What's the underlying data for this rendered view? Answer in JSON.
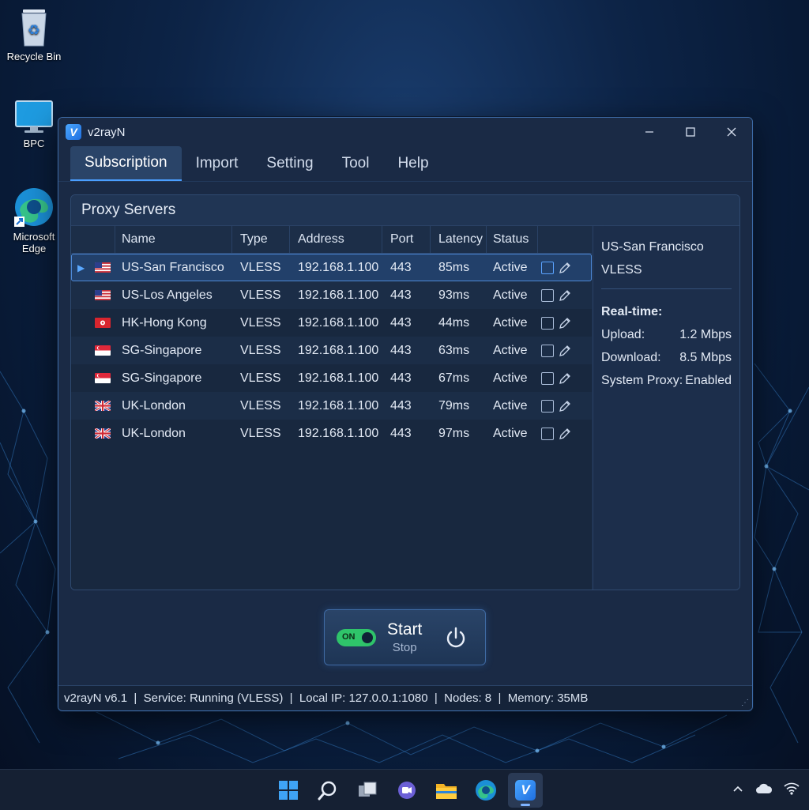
{
  "desktop": {
    "icons": [
      {
        "label": "Recycle Bin",
        "icon": "recycle-bin-icon"
      },
      {
        "label": "BPC",
        "icon": "monitor-icon"
      },
      {
        "label": "Microsoft Edge",
        "icon": "edge-icon"
      }
    ]
  },
  "window": {
    "title": "v2rayN",
    "controls": [
      "minimize-icon",
      "maximize-icon",
      "close-icon"
    ]
  },
  "menu": {
    "items": [
      {
        "label": "Subscription",
        "active": true
      },
      {
        "label": "Import"
      },
      {
        "label": "Setting"
      },
      {
        "label": "Tool"
      },
      {
        "label": "Help"
      }
    ]
  },
  "panel": {
    "title": "Proxy Servers",
    "columns": {
      "name": "Name",
      "type": "Type",
      "address": "Address",
      "port": "Port",
      "latency": "Latency",
      "status": "Status"
    },
    "rows": [
      {
        "flag": "us",
        "name": "US-San Francisco",
        "type": "VLESS",
        "address": "192.168.1.100",
        "port": "443",
        "latency": "85ms",
        "status": "Active",
        "selected": true
      },
      {
        "flag": "us",
        "name": "US-Los Angeles",
        "type": "VLESS",
        "address": "192.168.1.100",
        "port": "443",
        "latency": "93ms",
        "status": "Active"
      },
      {
        "flag": "hk",
        "name": "HK-Hong Kong",
        "type": "VLESS",
        "address": "192.168.1.100",
        "port": "443",
        "latency": "44ms",
        "status": "Active"
      },
      {
        "flag": "sg",
        "name": "SG-Singapore",
        "type": "VLESS",
        "address": "192.168.1.100",
        "port": "443",
        "latency": "63ms",
        "status": "Active"
      },
      {
        "flag": "sg",
        "name": "SG-Singapore",
        "type": "VLESS",
        "address": "192.168.1.100",
        "port": "443",
        "latency": "67ms",
        "status": "Active"
      },
      {
        "flag": "uk",
        "name": "UK-London",
        "type": "VLESS",
        "address": "192.168.1.100",
        "port": "443",
        "latency": "79ms",
        "status": "Active"
      },
      {
        "flag": "uk",
        "name": "UK-London",
        "type": "VLESS",
        "address": "192.168.1.100",
        "port": "443",
        "latency": "97ms",
        "status": "Active"
      }
    ]
  },
  "details": {
    "server_name": "US-San Francisco",
    "server_type": "VLESS",
    "realtime_label": "Real-time:",
    "upload_label": "Upload:",
    "upload_value": "1.2 Mbps",
    "download_label": "Download:",
    "download_value": "8.5 Mbps",
    "proxy_label": "System Proxy:",
    "proxy_value": "Enabled"
  },
  "control": {
    "toggle_label": "ON",
    "start_label": "Start",
    "stop_label": "Stop"
  },
  "statusbar": {
    "text": "v2rayN v6.1  |  Service: Running (VLESS)  |  Local IP: 127.0.0.1:1080  |  Nodes: 8  |  Memory: 35MB"
  },
  "taskbar": {
    "icons": [
      "windows-start-icon",
      "search-icon",
      "task-view-icon",
      "chat-icon",
      "file-explorer-icon",
      "edge-icon",
      "v2rayn-icon"
    ]
  },
  "colors": {
    "accent": "#4a9eff",
    "toggle_on": "#2fc46a",
    "window_bg": "#1a2a45"
  }
}
